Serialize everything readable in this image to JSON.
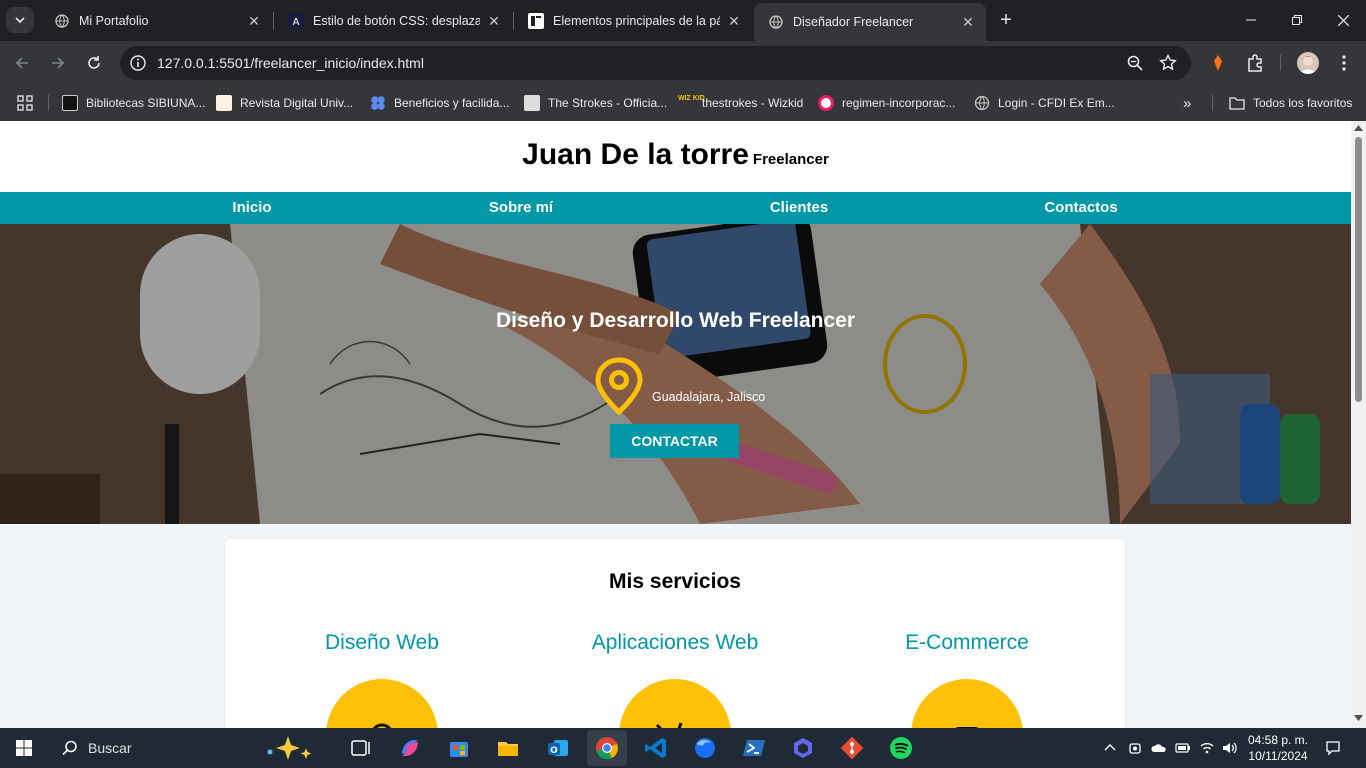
{
  "browser": {
    "tabs": [
      {
        "title": "Mi Portafolio",
        "active": false
      },
      {
        "title": "Estilo de botón CSS: desplazam",
        "active": false
      },
      {
        "title": "Elementos principales de la pág",
        "active": false
      },
      {
        "title": "Diseñador Freelancer",
        "active": true
      }
    ],
    "new_tab_label": "+",
    "url": "127.0.0.1:5501/freelancer_inicio/index.html",
    "bookmarks": [
      "Bibliotecas SIBIUNA...",
      "Revista Digital Univ...",
      "Beneficios y facilida...",
      "The Strokes - Officia...",
      "thestrokes - Wizkid",
      "regimen-incorporac...",
      "Login - CFDI Ex Em..."
    ],
    "bookmarks_overflow": "»",
    "all_bookmarks": "Todos los favoritos"
  },
  "site": {
    "name": "Juan De la torre",
    "role": "Freelancer",
    "nav": [
      "Inicio",
      "Sobre mí",
      "Clientes",
      "Contactos"
    ],
    "hero_title": "Diseño y Desarrollo Web Freelancer",
    "location": "Guadalajara, Jalisco",
    "cta": "CONTACTAR",
    "services_title": "Mis servicios",
    "services": [
      "Diseño Web",
      "Aplicaciones Web",
      "E-Commerce"
    ]
  },
  "taskbar": {
    "search_label": "Buscar",
    "time": "04:58 p. m.",
    "date": "10/11/2024"
  },
  "colors": {
    "brand_teal": "#0097a7",
    "accent_yellow": "#ffc107",
    "chrome_dark": "#202124",
    "chrome_toolbar": "#35363a"
  }
}
